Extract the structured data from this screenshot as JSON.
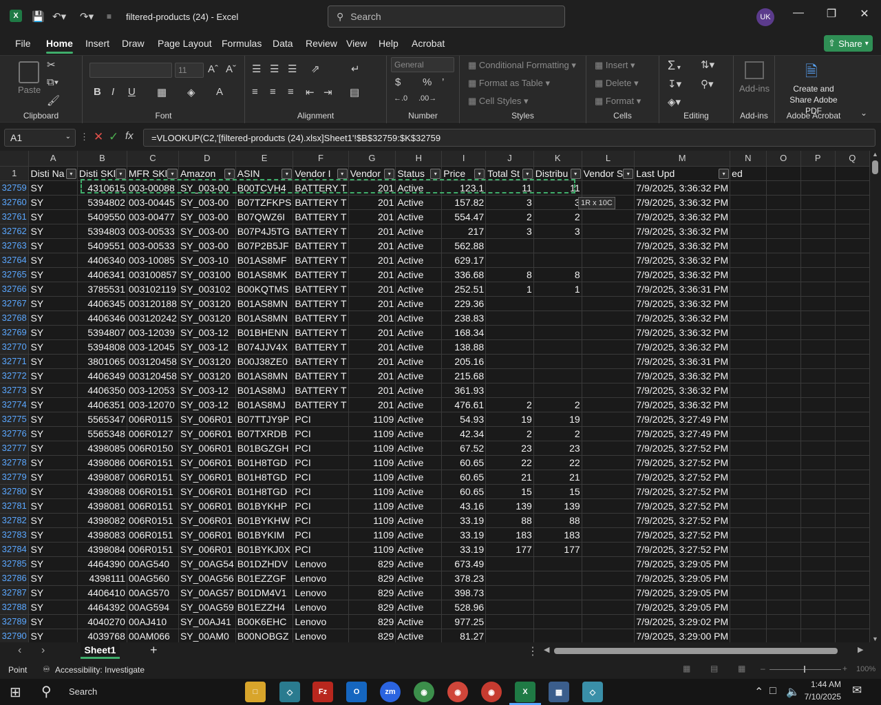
{
  "title_bar": {
    "doc_title": "filtered-products (24)  -  Excel",
    "search_placeholder": "Search",
    "avatar": "UK"
  },
  "menu_tabs": [
    "File",
    "Home",
    "Insert",
    "Draw",
    "Page Layout",
    "Formulas",
    "Data",
    "Review",
    "View",
    "Help",
    "Acrobat"
  ],
  "active_tab": "Home",
  "share_label": "Share",
  "ribbon": {
    "clipboard": {
      "paste": "Paste",
      "label": "Clipboard"
    },
    "font": {
      "size": "11",
      "label": "Font"
    },
    "alignment": {
      "label": "Alignment"
    },
    "number": {
      "format": "General",
      "label": "Number"
    },
    "styles": {
      "conditional": "Conditional Formatting",
      "format_table": "Format as Table",
      "cell_styles": "Cell Styles",
      "label": "Styles"
    },
    "cells": {
      "insert": "Insert",
      "delete": "Delete",
      "format": "Format",
      "label": "Cells"
    },
    "editing": {
      "label": "Editing"
    },
    "addins": {
      "addins": "Add-ins",
      "label": "Add-ins"
    },
    "acrobat": {
      "create": "Create and Share Adobe PDF",
      "label": "Adobe Acrobat"
    }
  },
  "formula_bar": {
    "name_box": "A1",
    "formula": "=VLOOKUP(C2,'[filtered-products (24).xlsx]Sheet1'!$B$32759:$K$32759"
  },
  "columns": [
    "A",
    "B",
    "C",
    "D",
    "E",
    "F",
    "G",
    "H",
    "I",
    "J",
    "K",
    "L",
    "M",
    "N",
    "O",
    "P",
    "Q"
  ],
  "header_row": {
    "row_number": "1",
    "cells": [
      "Disti Na",
      "Disti SKl",
      "MFR SKl",
      "Amazon",
      "ASIN",
      "Vendor I",
      "Vendor",
      "Status",
      "Price",
      "Total St",
      "Distribu",
      "Vendor S",
      "Last Upd",
      "ed",
      "",
      "",
      ""
    ]
  },
  "rows": [
    {
      "n": "32759",
      "c": [
        "SY",
        "4310615",
        "003-00088",
        "SY_003-00",
        "B00TCVH4",
        "BATTERY T",
        "201",
        "Active",
        "123.1",
        "11",
        "11",
        "",
        "7/9/2025, 3:36:32 PM"
      ]
    },
    {
      "n": "32760",
      "c": [
        "SY",
        "5394802",
        "003-00445",
        "SY_003-00",
        "B07TZFKPS",
        "BATTERY T",
        "201",
        "Active",
        "157.82",
        "3",
        "3",
        "",
        "7/9/2025, 3:36:32 PM"
      ]
    },
    {
      "n": "32761",
      "c": [
        "SY",
        "5409550",
        "003-00477",
        "SY_003-00",
        "B07QWZ6I",
        "BATTERY T",
        "201",
        "Active",
        "554.47",
        "2",
        "2",
        "",
        "7/9/2025, 3:36:32 PM"
      ]
    },
    {
      "n": "32762",
      "c": [
        "SY",
        "5394803",
        "003-00533",
        "SY_003-00",
        "B07P4J5TG",
        "BATTERY T",
        "201",
        "Active",
        "217",
        "3",
        "3",
        "",
        "7/9/2025, 3:36:32 PM"
      ]
    },
    {
      "n": "32763",
      "c": [
        "SY",
        "5409551",
        "003-00533",
        "SY_003-00",
        "B07P2B5JF",
        "BATTERY T",
        "201",
        "Active",
        "562.88",
        "",
        "",
        "",
        "7/9/2025, 3:36:32 PM"
      ]
    },
    {
      "n": "32764",
      "c": [
        "SY",
        "4406340",
        "003-10085",
        "SY_003-10",
        "B01AS8MF",
        "BATTERY T",
        "201",
        "Active",
        "629.17",
        "",
        "",
        "",
        "7/9/2025, 3:36:32 PM"
      ]
    },
    {
      "n": "32765",
      "c": [
        "SY",
        "4406341",
        "003100857",
        "SY_003100",
        "B01AS8MK",
        "BATTERY T",
        "201",
        "Active",
        "336.68",
        "8",
        "8",
        "",
        "7/9/2025, 3:36:32 PM"
      ]
    },
    {
      "n": "32766",
      "c": [
        "SY",
        "3785531",
        "003102119",
        "SY_003102",
        "B00KQTMS",
        "BATTERY T",
        "201",
        "Active",
        "252.51",
        "1",
        "1",
        "",
        "7/9/2025, 3:36:31 PM"
      ]
    },
    {
      "n": "32767",
      "c": [
        "SY",
        "4406345",
        "003120188",
        "SY_003120",
        "B01AS8MN",
        "BATTERY T",
        "201",
        "Active",
        "229.36",
        "",
        "",
        "",
        "7/9/2025, 3:36:32 PM"
      ]
    },
    {
      "n": "32768",
      "c": [
        "SY",
        "4406346",
        "003120242",
        "SY_003120",
        "B01AS8MN",
        "BATTERY T",
        "201",
        "Active",
        "238.83",
        "",
        "",
        "",
        "7/9/2025, 3:36:32 PM"
      ]
    },
    {
      "n": "32769",
      "c": [
        "SY",
        "5394807",
        "003-12039",
        "SY_003-12",
        "B01BHENN",
        "BATTERY T",
        "201",
        "Active",
        "168.34",
        "",
        "",
        "",
        "7/9/2025, 3:36:32 PM"
      ]
    },
    {
      "n": "32770",
      "c": [
        "SY",
        "5394808",
        "003-12045",
        "SY_003-12",
        "B074JJV4X",
        "BATTERY T",
        "201",
        "Active",
        "138.88",
        "",
        "",
        "",
        "7/9/2025, 3:36:32 PM"
      ]
    },
    {
      "n": "32771",
      "c": [
        "SY",
        "3801065",
        "003120458",
        "SY_003120",
        "B00J38ZE0",
        "BATTERY T",
        "201",
        "Active",
        "205.16",
        "",
        "",
        "",
        "7/9/2025, 3:36:31 PM"
      ]
    },
    {
      "n": "32772",
      "c": [
        "SY",
        "4406349",
        "003120458",
        "SY_003120",
        "B01AS8MN",
        "BATTERY T",
        "201",
        "Active",
        "215.68",
        "",
        "",
        "",
        "7/9/2025, 3:36:32 PM"
      ]
    },
    {
      "n": "32773",
      "c": [
        "SY",
        "4406350",
        "003-12053",
        "SY_003-12",
        "B01AS8MJ",
        "BATTERY T",
        "201",
        "Active",
        "361.93",
        "",
        "",
        "",
        "7/9/2025, 3:36:32 PM"
      ]
    },
    {
      "n": "32774",
      "c": [
        "SY",
        "4406351",
        "003-12070",
        "SY_003-12",
        "B01AS8MJ",
        "BATTERY T",
        "201",
        "Active",
        "476.61",
        "2",
        "2",
        "",
        "7/9/2025, 3:36:32 PM"
      ]
    },
    {
      "n": "32775",
      "c": [
        "SY",
        "5565347",
        "006R0115",
        "SY_006R01",
        "B07TTJY9P",
        "PCI",
        "1109",
        "Active",
        "54.93",
        "19",
        "19",
        "",
        "7/9/2025, 3:27:49 PM"
      ]
    },
    {
      "n": "32776",
      "c": [
        "SY",
        "5565348",
        "006R0127",
        "SY_006R01",
        "B07TXRDB",
        "PCI",
        "1109",
        "Active",
        "42.34",
        "2",
        "2",
        "",
        "7/9/2025, 3:27:49 PM"
      ]
    },
    {
      "n": "32777",
      "c": [
        "SY",
        "4398085",
        "006R0150",
        "SY_006R01",
        "B01BGZGH",
        "PCI",
        "1109",
        "Active",
        "67.52",
        "23",
        "23",
        "",
        "7/9/2025, 3:27:52 PM"
      ]
    },
    {
      "n": "32778",
      "c": [
        "SY",
        "4398086",
        "006R0151",
        "SY_006R01",
        "B01H8TGD",
        "PCI",
        "1109",
        "Active",
        "60.65",
        "22",
        "22",
        "",
        "7/9/2025, 3:27:52 PM"
      ]
    },
    {
      "n": "32779",
      "c": [
        "SY",
        "4398087",
        "006R0151",
        "SY_006R01",
        "B01H8TGD",
        "PCI",
        "1109",
        "Active",
        "60.65",
        "21",
        "21",
        "",
        "7/9/2025, 3:27:52 PM"
      ]
    },
    {
      "n": "32780",
      "c": [
        "SY",
        "4398088",
        "006R0151",
        "SY_006R01",
        "B01H8TGD",
        "PCI",
        "1109",
        "Active",
        "60.65",
        "15",
        "15",
        "",
        "7/9/2025, 3:27:52 PM"
      ]
    },
    {
      "n": "32781",
      "c": [
        "SY",
        "4398081",
        "006R0151",
        "SY_006R01",
        "B01BYKHP",
        "PCI",
        "1109",
        "Active",
        "43.16",
        "139",
        "139",
        "",
        "7/9/2025, 3:27:52 PM"
      ]
    },
    {
      "n": "32782",
      "c": [
        "SY",
        "4398082",
        "006R0151",
        "SY_006R01",
        "B01BYKHW",
        "PCI",
        "1109",
        "Active",
        "33.19",
        "88",
        "88",
        "",
        "7/9/2025, 3:27:52 PM"
      ]
    },
    {
      "n": "32783",
      "c": [
        "SY",
        "4398083",
        "006R0151",
        "SY_006R01",
        "B01BYKIM",
        "PCI",
        "1109",
        "Active",
        "33.19",
        "183",
        "183",
        "",
        "7/9/2025, 3:27:52 PM"
      ]
    },
    {
      "n": "32784",
      "c": [
        "SY",
        "4398084",
        "006R0151",
        "SY_006R01",
        "B01BYKJ0X",
        "PCI",
        "1109",
        "Active",
        "33.19",
        "177",
        "177",
        "",
        "7/9/2025, 3:27:52 PM"
      ]
    },
    {
      "n": "32785",
      "c": [
        "SY",
        "4464390",
        "00AG540",
        "SY_00AG54",
        "B01DZHDV",
        "Lenovo",
        "829",
        "Active",
        "673.49",
        "",
        "",
        "",
        "7/9/2025, 3:29:05 PM"
      ]
    },
    {
      "n": "32786",
      "c": [
        "SY",
        "4398111",
        "00AG560",
        "SY_00AG56",
        "B01EZZGF",
        "Lenovo",
        "829",
        "Active",
        "378.23",
        "",
        "",
        "",
        "7/9/2025, 3:29:05 PM"
      ]
    },
    {
      "n": "32787",
      "c": [
        "SY",
        "4406410",
        "00AG570",
        "SY_00AG57",
        "B01DM4V1",
        "Lenovo",
        "829",
        "Active",
        "398.73",
        "",
        "",
        "",
        "7/9/2025, 3:29:05 PM"
      ]
    },
    {
      "n": "32788",
      "c": [
        "SY",
        "4464392",
        "00AG594",
        "SY_00AG59",
        "B01EZZH4",
        "Lenovo",
        "829",
        "Active",
        "528.96",
        "",
        "",
        "",
        "7/9/2025, 3:29:05 PM"
      ]
    },
    {
      "n": "32789",
      "c": [
        "SY",
        "4040270",
        "00AJ410",
        "SY_00AJ41",
        "B00K6EHC",
        "Lenovo",
        "829",
        "Active",
        "977.25",
        "",
        "",
        "",
        "7/9/2025, 3:29:02 PM"
      ]
    },
    {
      "n": "32790",
      "c": [
        "SY",
        "4039768",
        "00AM066",
        "SY_00AM0",
        "B00NOBGZ",
        "Lenovo",
        "829",
        "Active",
        "81.27",
        "",
        "",
        "",
        "7/9/2025, 3:29:00 PM"
      ]
    }
  ],
  "copy_tooltip": "1R x 10C",
  "sheet_tab": "Sheet1",
  "status": {
    "mode": "Point",
    "accessibility": "Accessibility: Investigate",
    "zoom": "100%"
  },
  "taskbar": {
    "search": "Search",
    "time": "1:44 AM",
    "date": "7/10/2025"
  },
  "colors": {
    "accent_green": "#3fae6b",
    "row_header_blue": "#5aa7ff",
    "background": "#1a1a1a"
  }
}
